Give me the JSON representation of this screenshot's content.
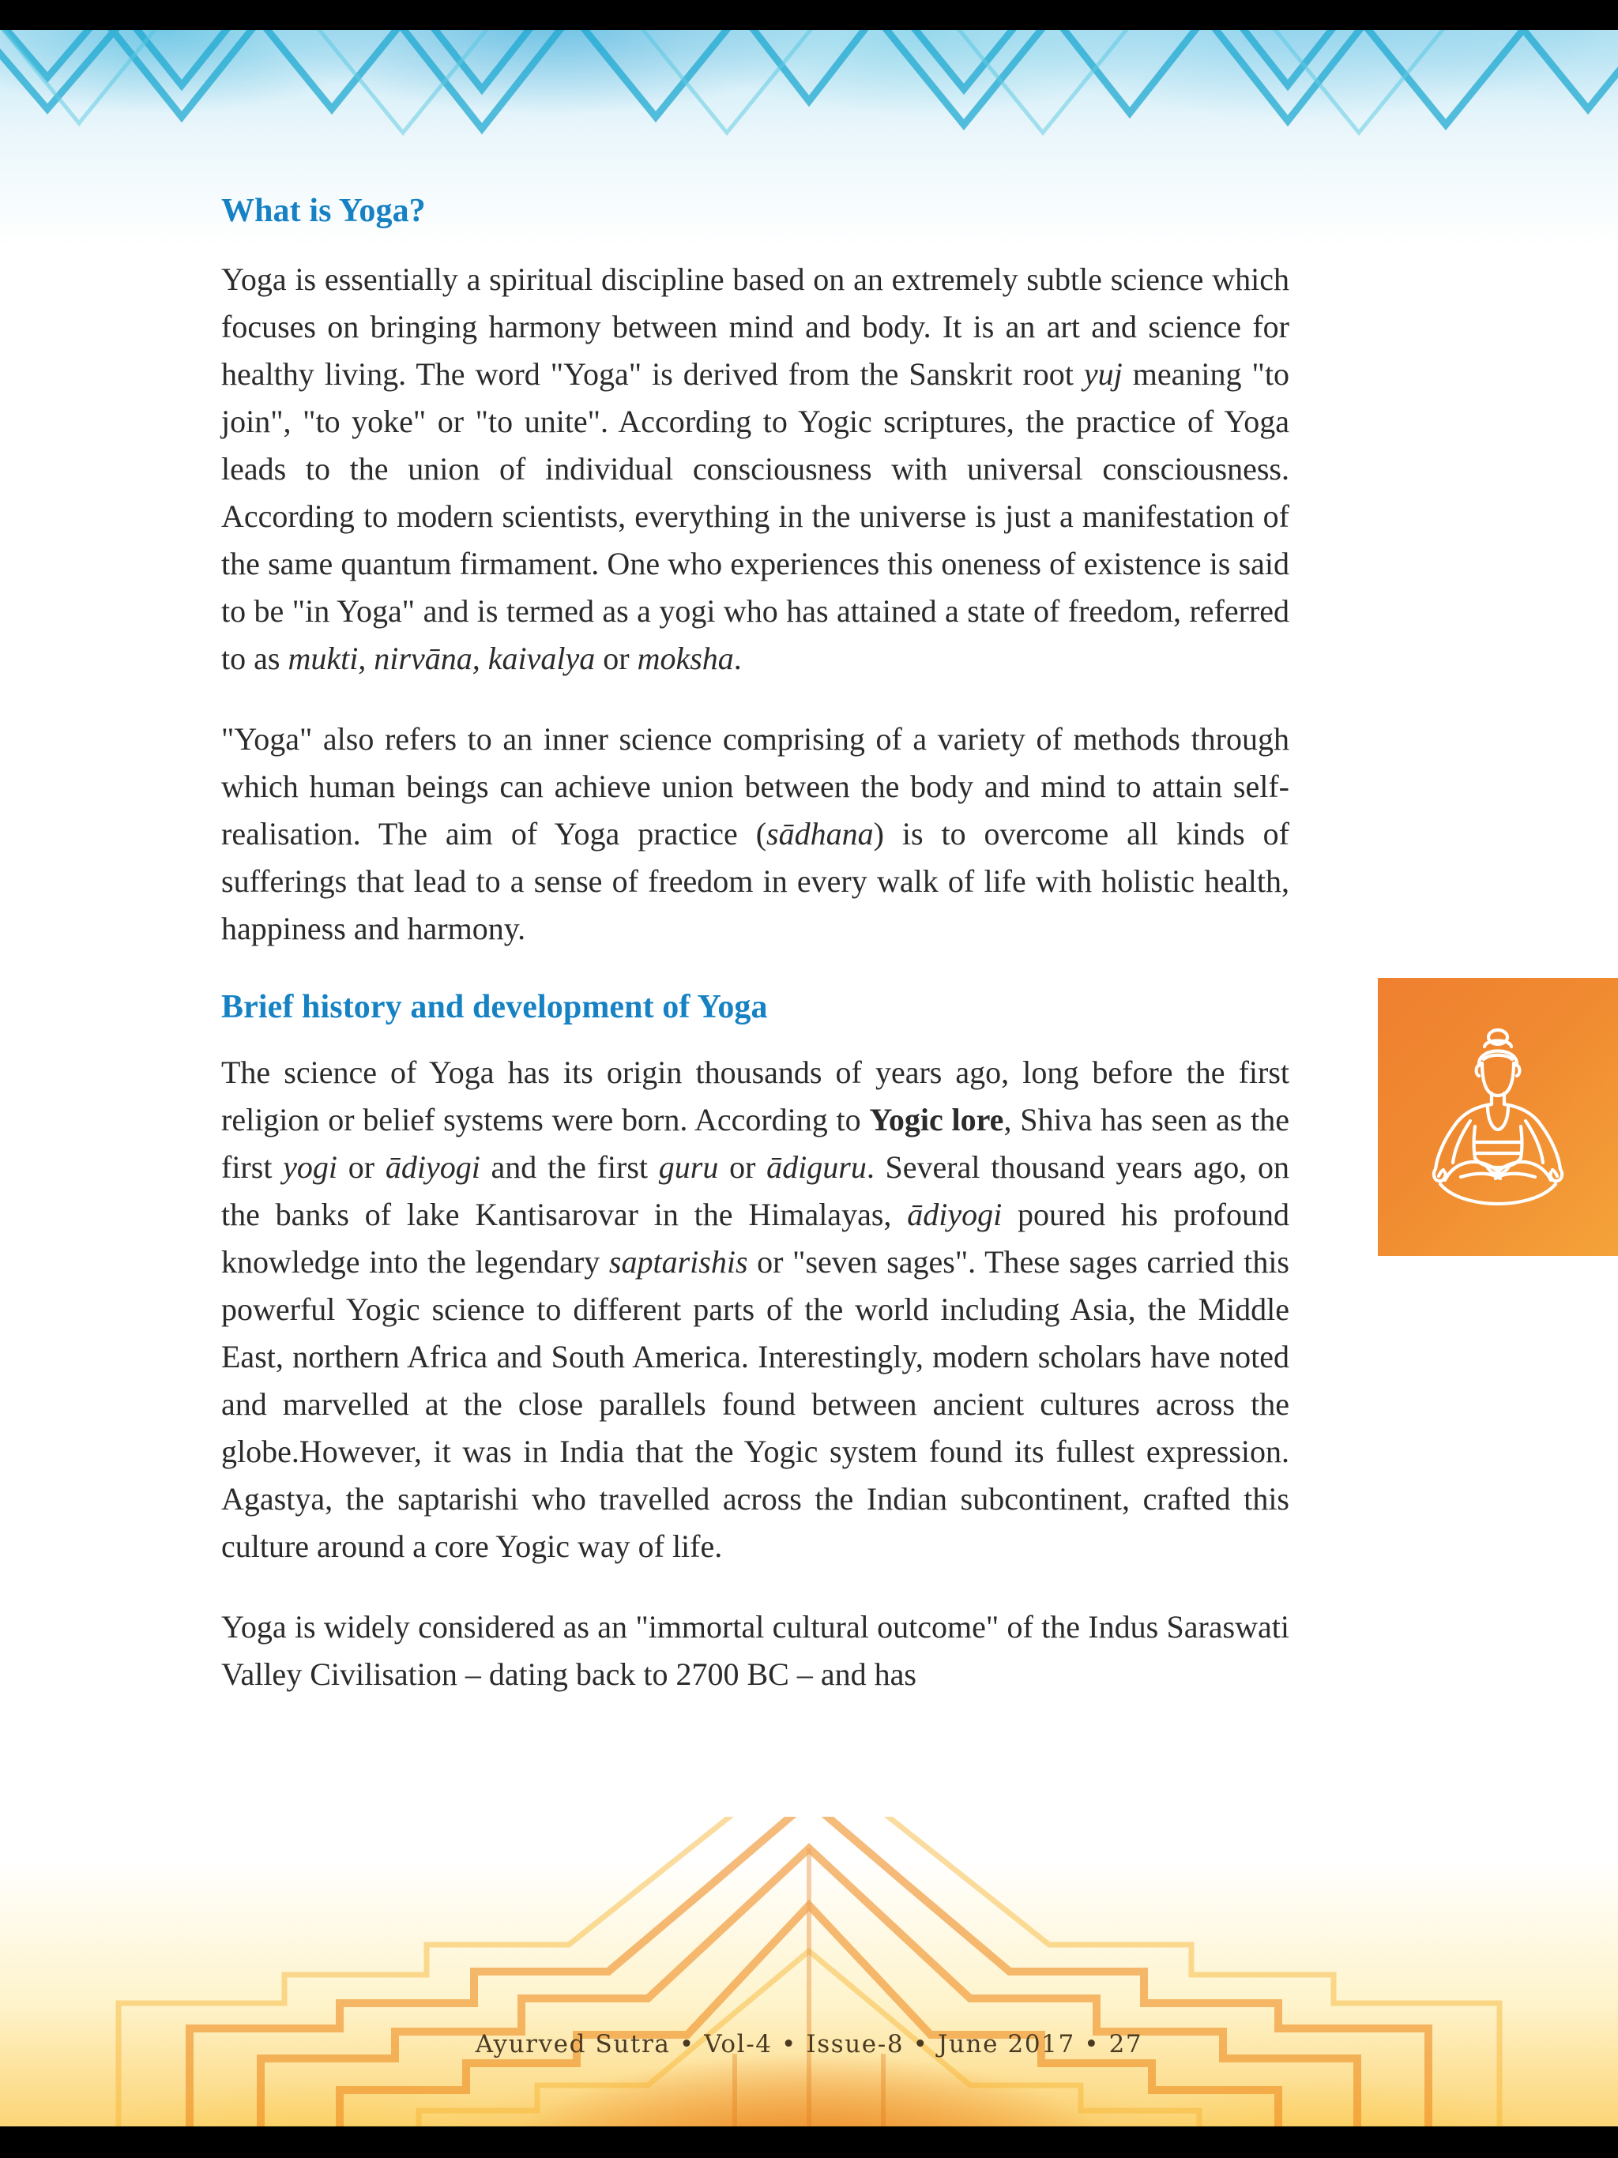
{
  "document": {
    "publication": "Ayurved Sutra",
    "volume": "Vol-4",
    "issue": "Issue-8",
    "date": "June 2017",
    "page_number": "27",
    "footer_text": "Ayurved Sutra  •  Vol-4  •  Issue-8  •  June 2017  •  27"
  },
  "colors": {
    "heading_blue": "#1682c4",
    "panel_orange_start": "#ef8030",
    "panel_orange_end": "#f5a33a",
    "body_text": "#2b2b2b",
    "footer_text": "#4a3a22",
    "letterbox": "#000000",
    "top_band_blue": "#5abee1",
    "bottom_band_orange": "#f3a028"
  },
  "sections": [
    {
      "id": "what-is-yoga",
      "heading": "What is Yoga?",
      "paragraphs": [
        {
          "id": "para-definition",
          "runs": [
            {
              "text": "Yoga is essentially a spiritual discipline based on an extremely subtle science which focuses on bringing harmony between mind and body. It is an art and science for healthy living. The word \"Yoga\" is derived from the Sanskrit root ",
              "style": "normal"
            },
            {
              "text": "yuj",
              "style": "italic"
            },
            {
              "text": " meaning \"to join\", \"to yoke\" or \"to unite\". According to Yogic scriptures, the practice of Yoga leads to the union of individual consciousness with universal consciousness. According to modern scientists, everything in the universe is just a manifestation of the same quantum firmament. One who experiences this oneness of existence is said to be \"in Yoga\" and is termed as a yogi who has attained a state of freedom, referred to as ",
              "style": "normal"
            },
            {
              "text": "mukti, nirvāna, kaivalya",
              "style": "italic"
            },
            {
              "text": " or ",
              "style": "normal"
            },
            {
              "text": "moksha",
              "style": "italic"
            },
            {
              "text": ".",
              "style": "normal"
            }
          ]
        },
        {
          "id": "para-inner-science",
          "runs": [
            {
              "text": "\"Yoga\" also refers to an inner science comprising of a variety of methods through which human beings can achieve union between the body and mind to attain self-realisation. The aim of Yoga practice (",
              "style": "normal"
            },
            {
              "text": "sādhana",
              "style": "italic"
            },
            {
              "text": ") is to overcome all kinds of sufferings that lead to a sense of freedom in every walk of life with holistic health, happiness and harmony.",
              "style": "normal"
            }
          ]
        }
      ]
    },
    {
      "id": "brief-history",
      "heading": "Brief history and development of Yoga",
      "paragraphs": [
        {
          "id": "para-origin",
          "runs": [
            {
              "text": "The science of Yoga has its origin thousands of years ago, long before the first religion or belief systems were born. According to ",
              "style": "normal"
            },
            {
              "text": "Yogic lore",
              "style": "bold"
            },
            {
              "text": ", Shiva has seen as the first ",
              "style": "normal"
            },
            {
              "text": "yogi",
              "style": "italic"
            },
            {
              "text": " or ",
              "style": "normal"
            },
            {
              "text": "ādiyogi",
              "style": "italic"
            },
            {
              "text": " and the first ",
              "style": "normal"
            },
            {
              "text": "guru",
              "style": "italic"
            },
            {
              "text": " or ",
              "style": "normal"
            },
            {
              "text": "ādiguru",
              "style": "italic"
            },
            {
              "text": ". Several thousand years ago, on the banks of lake Kantisarovar in the Himalayas, ",
              "style": "normal"
            },
            {
              "text": "ādiyogi",
              "style": "italic"
            },
            {
              "text": " poured his profound knowledge into the legendary ",
              "style": "normal"
            },
            {
              "text": "saptarishis",
              "style": "italic"
            },
            {
              "text": " or \"seven sages\". These sages carried this powerful Yogic science to different parts of the world including Asia, the Middle East, northern Africa and South America. Interestingly, modern scholars have noted and marvelled at the close parallels found between ancient cultures across the globe.However, it was in India that the Yogic system found its fullest expression. Agastya, the saptarishi who travelled across the Indian subcontinent, crafted this culture around a core Yogic way of life.",
              "style": "normal"
            }
          ]
        },
        {
          "id": "para-immortal",
          "runs": [
            {
              "text": "Yoga is widely considered as an \"immortal cultural outcome\" of the Indus Saraswati Valley Civilisation – dating back to 2700 BC – and has",
              "style": "normal"
            }
          ]
        }
      ]
    }
  ],
  "side_panel": {
    "icon_name": "meditation-lotus-pose-icon",
    "alt": "Person seated in lotus meditation pose"
  }
}
